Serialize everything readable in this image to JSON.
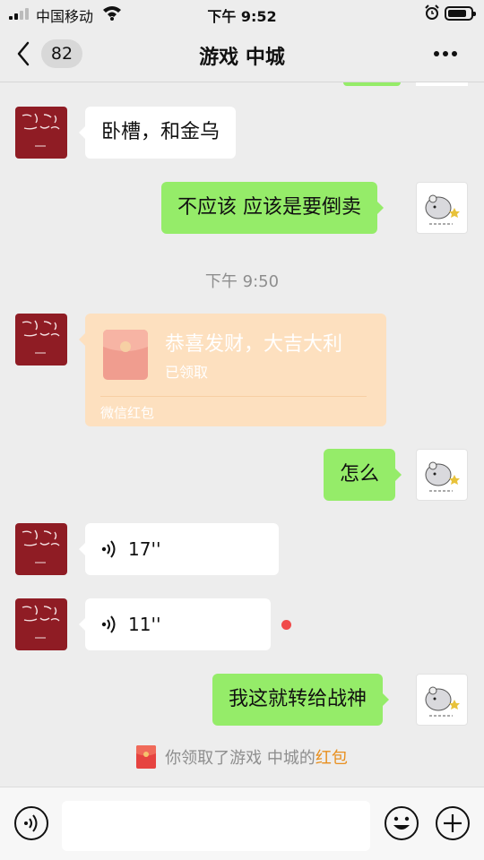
{
  "status_bar": {
    "carrier": "中国移动",
    "time": "下午 9:52"
  },
  "nav": {
    "unread_count": "82",
    "title": "游戏 中城"
  },
  "messages": {
    "m1": "卧槽，和金乌",
    "m2": "不应该 应该是要倒卖",
    "timestamp": "下午 9:50",
    "red_packet": {
      "greeting": "恭喜发财，大吉大利",
      "status": "已领取",
      "footer": "微信红包"
    },
    "m3": "怎么",
    "voice1": "17''",
    "voice2": "11''",
    "m4": "我这就转给战神"
  },
  "system_notice": {
    "prefix": "你领取了游戏 中城的",
    "highlight": "红包"
  },
  "colors": {
    "sent_bubble": "#95ec69",
    "received_bubble": "#ffffff",
    "red_packet": "#fde0bf",
    "highlight": "#e88f1e",
    "unread_dot": "#f04b4b"
  },
  "icons": [
    "signal-icon",
    "wifi-icon",
    "alarm-icon",
    "battery-icon",
    "back-icon",
    "more-icon",
    "voice-icon",
    "emoji-icon",
    "plus-icon",
    "red-packet-icon"
  ]
}
